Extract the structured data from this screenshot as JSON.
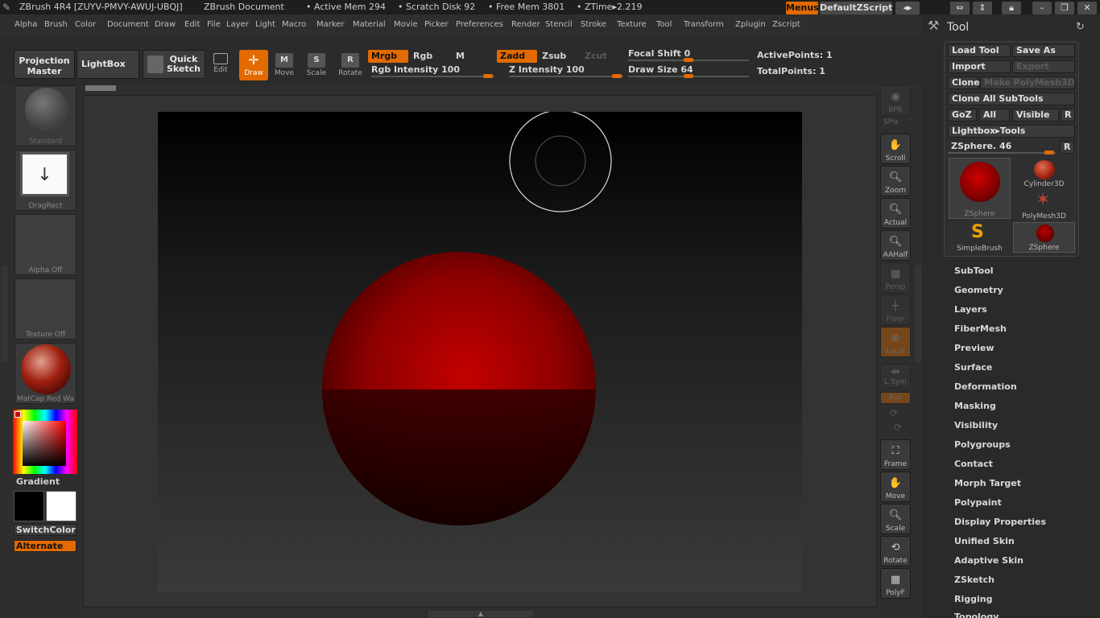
{
  "titlebar": {
    "app": "ZBrush 4R4 [ZUYV-PMVY-AWUJ-UBQJ]",
    "document": "ZBrush Document",
    "active_mem": "• Active Mem 294",
    "scratch_disk": "• Scratch Disk 92",
    "free_mem": "• Free Mem 3801",
    "ztime": "• ZTime▸2.219",
    "menus_btn": "Menus",
    "zscript_btn": "DefaultZScript"
  },
  "menubar": [
    "Alpha",
    "Brush",
    "Color",
    "Document",
    "Draw",
    "Edit",
    "File",
    "Layer",
    "Light",
    "Macro",
    "Marker",
    "Material",
    "Movie",
    "Picker",
    "Preferences",
    "Render",
    "Stencil",
    "Stroke",
    "Texture",
    "Tool",
    "Transform",
    "Zplugin",
    "Zscript"
  ],
  "toolbar": {
    "projection_master": "Projection Master",
    "lightbox": "LightBox",
    "quick_sketch": "Quick Sketch",
    "edit": "Edit",
    "draw": "Draw",
    "move": "Move",
    "scale": "Scale",
    "rotate": "Rotate",
    "mrgb": "Mrgb",
    "rgb": "Rgb",
    "m": "M",
    "zadd": "Zadd",
    "zsub": "Zsub",
    "zcut": "Zcut",
    "rgb_intensity": "Rgb Intensity 100",
    "z_intensity": "Z Intensity 100",
    "focal_shift": "Focal Shift 0",
    "draw_size": "Draw Size 64",
    "active_points": "ActivePoints: 1",
    "total_points": "TotalPoints: 1"
  },
  "leftshelf": {
    "brush": "Standard",
    "stroke": "DragRect",
    "alpha": "Alpha Off",
    "texture": "Texture Off",
    "material": "MatCap Red Wa",
    "gradient": "Gradient",
    "switchcolor": "SwitchColor",
    "alternate": "Alternate"
  },
  "rightshelf": [
    "BPR",
    "SPix",
    "Scroll",
    "Zoom",
    "Actual",
    "AAHalf",
    "Persp",
    "Floor",
    "Local",
    "L.Sym",
    "Xyz",
    "Frame",
    "Move",
    "Scale",
    "Rotate",
    "PolyF"
  ],
  "toolpanel": {
    "title": "Tool",
    "load_tool": "Load Tool",
    "save_as": "Save As",
    "import": "Import",
    "export": "Export",
    "clone": "Clone",
    "make_polymesh": "Make PolyMesh3D",
    "clone_all": "Clone All SubTools",
    "goz": "GoZ",
    "all": "All",
    "visible": "Visible",
    "r": "R",
    "lightbox_tools": "Lightbox▸Tools",
    "zsphere_slider": "ZSphere. 46",
    "tools": [
      "ZSphere",
      "Cylinder3D",
      "PolyMesh3D",
      "SimpleBrush",
      "ZSphere"
    ],
    "sections": [
      "SubTool",
      "Geometry",
      "Layers",
      "FiberMesh",
      "Preview",
      "Surface",
      "Deformation",
      "Masking",
      "Visibility",
      "Polygroups",
      "Contact",
      "Morph Target",
      "Polypaint",
      "Display Properties",
      "Unified Skin",
      "Adaptive Skin",
      "ZSketch",
      "Rigging",
      "Topology"
    ]
  },
  "colors": {
    "accent": "#e26a00",
    "sphere": "#b00000"
  }
}
